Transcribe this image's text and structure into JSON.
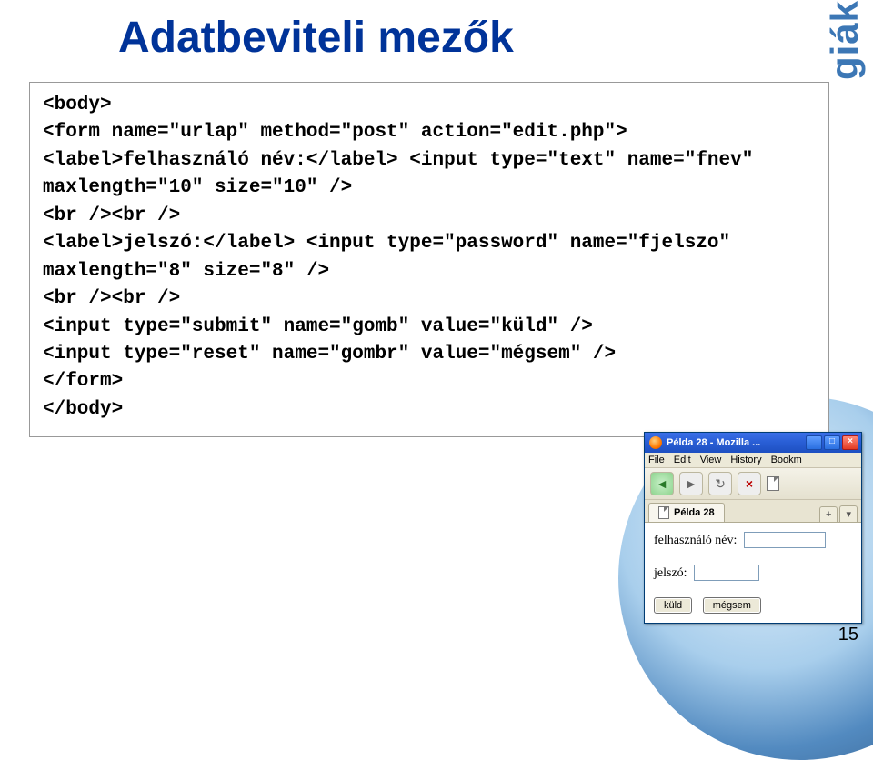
{
  "title": "Adatbeviteli mezők",
  "side_text": "giák",
  "page_number": "15",
  "code": "<body>\n<form name=\"urlap\" method=\"post\" action=\"edit.php\">\n<label>felhasználó név:</label> <input type=\"text\" name=\"fnev\" maxlength=\"10\" size=\"10\" />\n<br /><br />\n<label>jelszó:</label> <input type=\"password\" name=\"fjelszo\" maxlength=\"8\" size=\"8\" />\n<br /><br />\n<input type=\"submit\" name=\"gomb\" value=\"küld\" />\n<input type=\"reset\" name=\"gombr\" value=\"mégsem\" />\n</form>\n</body>",
  "browser": {
    "window_title": "Példa 28 - Mozilla ...",
    "menu": {
      "file": "File",
      "edit": "Edit",
      "view": "View",
      "history": "History",
      "bookmarks": "Bookm"
    },
    "tab_label": "Példa 28",
    "win_min": "_",
    "win_max": "□",
    "win_close": "×",
    "nav_back": "◄",
    "nav_fwd": "►",
    "nav_reload": "↻",
    "nav_stop": "×",
    "tab_plus": "+",
    "tab_dd": "▾"
  },
  "form": {
    "user_label": "felhasználó név:",
    "pass_label": "jelszó:",
    "submit": "küld",
    "reset": "mégsem"
  }
}
